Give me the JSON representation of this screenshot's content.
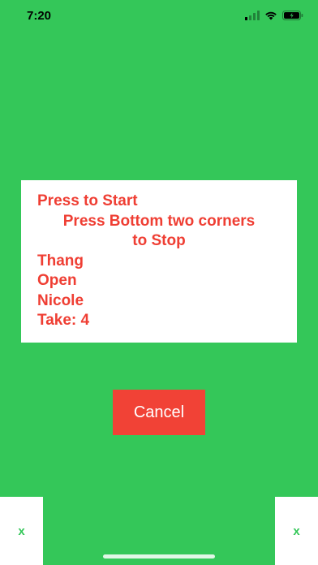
{
  "status_bar": {
    "time": "7:20",
    "icons": [
      "signal-icon",
      "wifi-icon",
      "battery-icon"
    ]
  },
  "card": {
    "line1": "Press to Start",
    "line2": "Press Bottom two corners",
    "line3": "to Stop",
    "line4": "Thang",
    "line5": "Open",
    "line6": "Nicole",
    "line7": "Take: 4"
  },
  "cancel_button": {
    "label": "Cancel"
  },
  "corners": {
    "left_label": "x",
    "right_label": "x"
  },
  "colors": {
    "background": "#34c759",
    "text_red": "#ef3e33",
    "button_red": "#f14236",
    "corner_text": "#34c759"
  }
}
